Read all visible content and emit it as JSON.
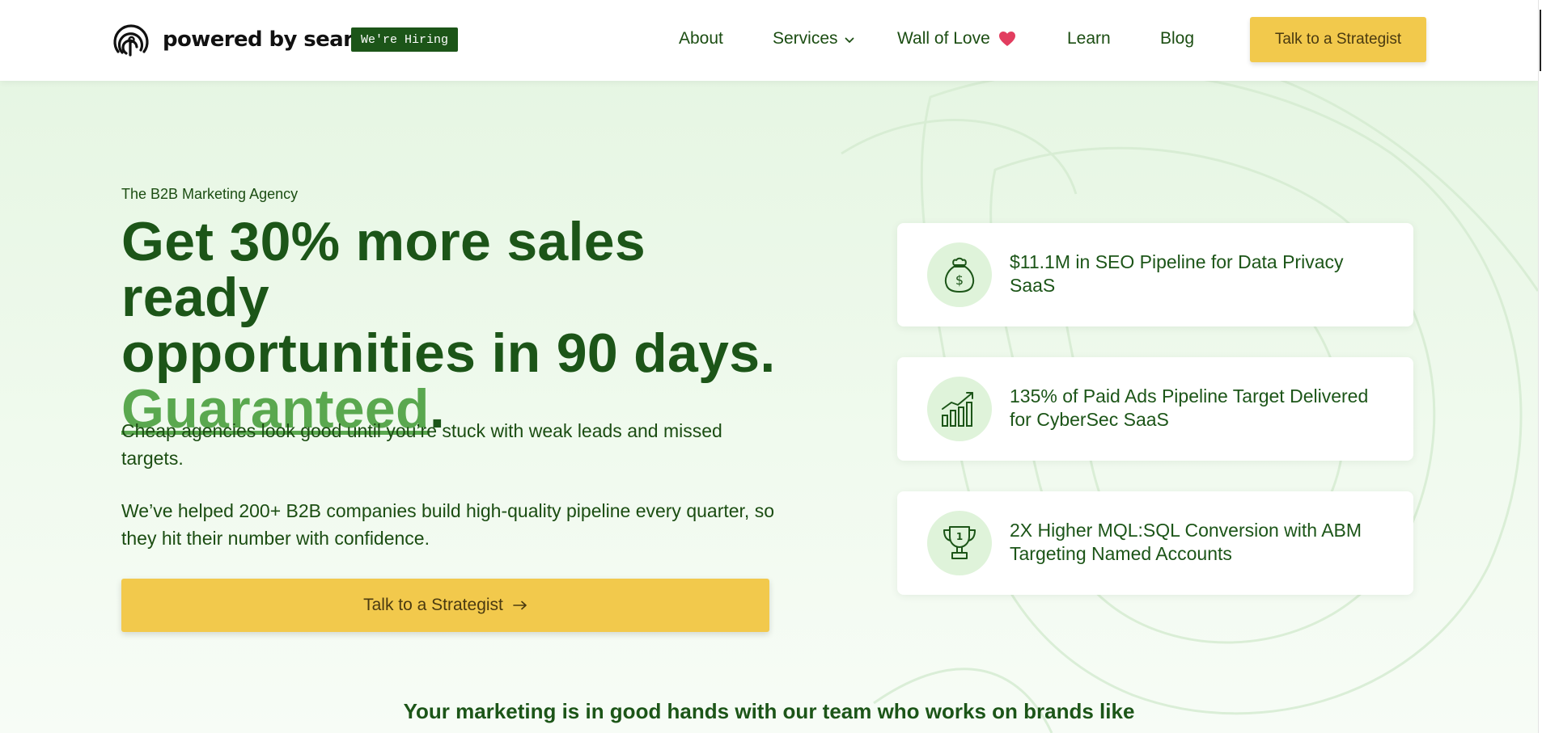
{
  "nav": {
    "logo_text": "powered by search",
    "hiring_badge": "We're Hiring",
    "items": [
      {
        "label": "About"
      },
      {
        "label": "Services"
      },
      {
        "label": "Wall of Love"
      },
      {
        "label": "Learn"
      },
      {
        "label": "Blog"
      }
    ],
    "cta_label": "Talk to a Strategist",
    "icons": {
      "logo": "fingerprint-logo-icon",
      "services": "chevron-down-icon",
      "wall_of_love": "heart-icon"
    }
  },
  "hero": {
    "eyebrow": "The B2B Marketing Agency",
    "headline_line1": "Get 30% more sales ready",
    "headline_line2": "opportunities in 90 days.",
    "headline_accent": "Guaranteed",
    "headline_period": ".",
    "paragraph1": "Cheap agencies look good until you’re stuck with weak leads and missed targets.",
    "paragraph2": "We’ve helped 200+ B2B companies build high-quality pipeline every quarter, so they hit their number with confidence.",
    "cta_label": "Talk to a Strategist",
    "cta_icon": "arrow-right-icon",
    "stats": [
      {
        "icon": "money-bag-icon",
        "text": "$11.1M in SEO Pipeline for Data Privacy SaaS"
      },
      {
        "icon": "growth-chart-icon",
        "text": "135% of Paid Ads Pipeline Target Delivered for CyberSec SaaS"
      },
      {
        "icon": "trophy-icon",
        "text": "2X Higher MQL:SQL Conversion with ABM Targeting Named Accounts"
      }
    ]
  },
  "brands_heading": "Your marketing is in good hands with our team who works on brands like",
  "colors": {
    "brand_dark_green": "#1c5518",
    "accent_green": "#5aa84f",
    "cta_yellow": "#f2c94c",
    "hero_background": "#e6f6e3",
    "icon_circle": "#dff3da",
    "heart": "#e23d5f"
  }
}
